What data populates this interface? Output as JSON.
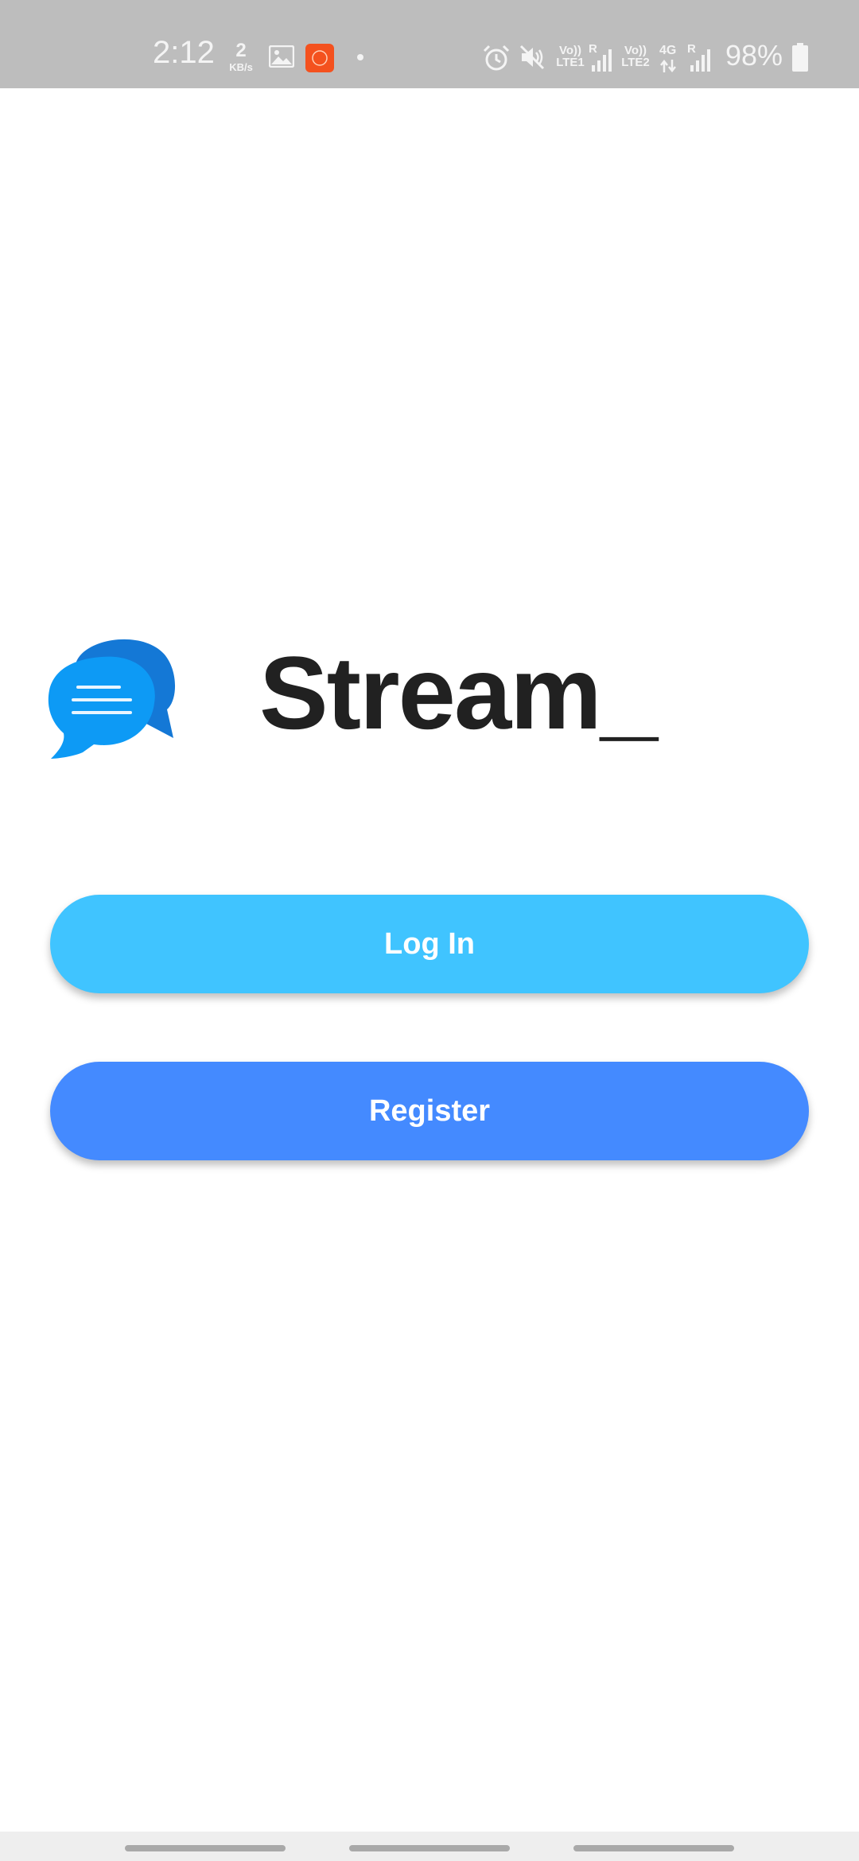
{
  "status_bar": {
    "time": "2:12",
    "data_speed_value": "2",
    "data_speed_unit": "KB/s",
    "sim1_label": "Vo)) LTE1",
    "sim1_roaming": "R",
    "sim2_label": "Vo)) LTE2",
    "sim2_network": "4G",
    "sim2_roaming": "R",
    "battery_percent": "98%",
    "icons": [
      "gallery-icon",
      "app-notification-icon",
      "dot-icon",
      "alarm-icon",
      "mute-icon",
      "signal-icon",
      "signal-icon",
      "battery-icon"
    ]
  },
  "app": {
    "title": "Stream_",
    "logo_icon": "chat-bubbles-icon",
    "colors": {
      "login": "#40c4ff",
      "register": "#448aff",
      "logo_front": "#0d9af5",
      "logo_back": "#1478d6"
    }
  },
  "actions": {
    "login_label": "Log In",
    "register_label": "Register"
  }
}
